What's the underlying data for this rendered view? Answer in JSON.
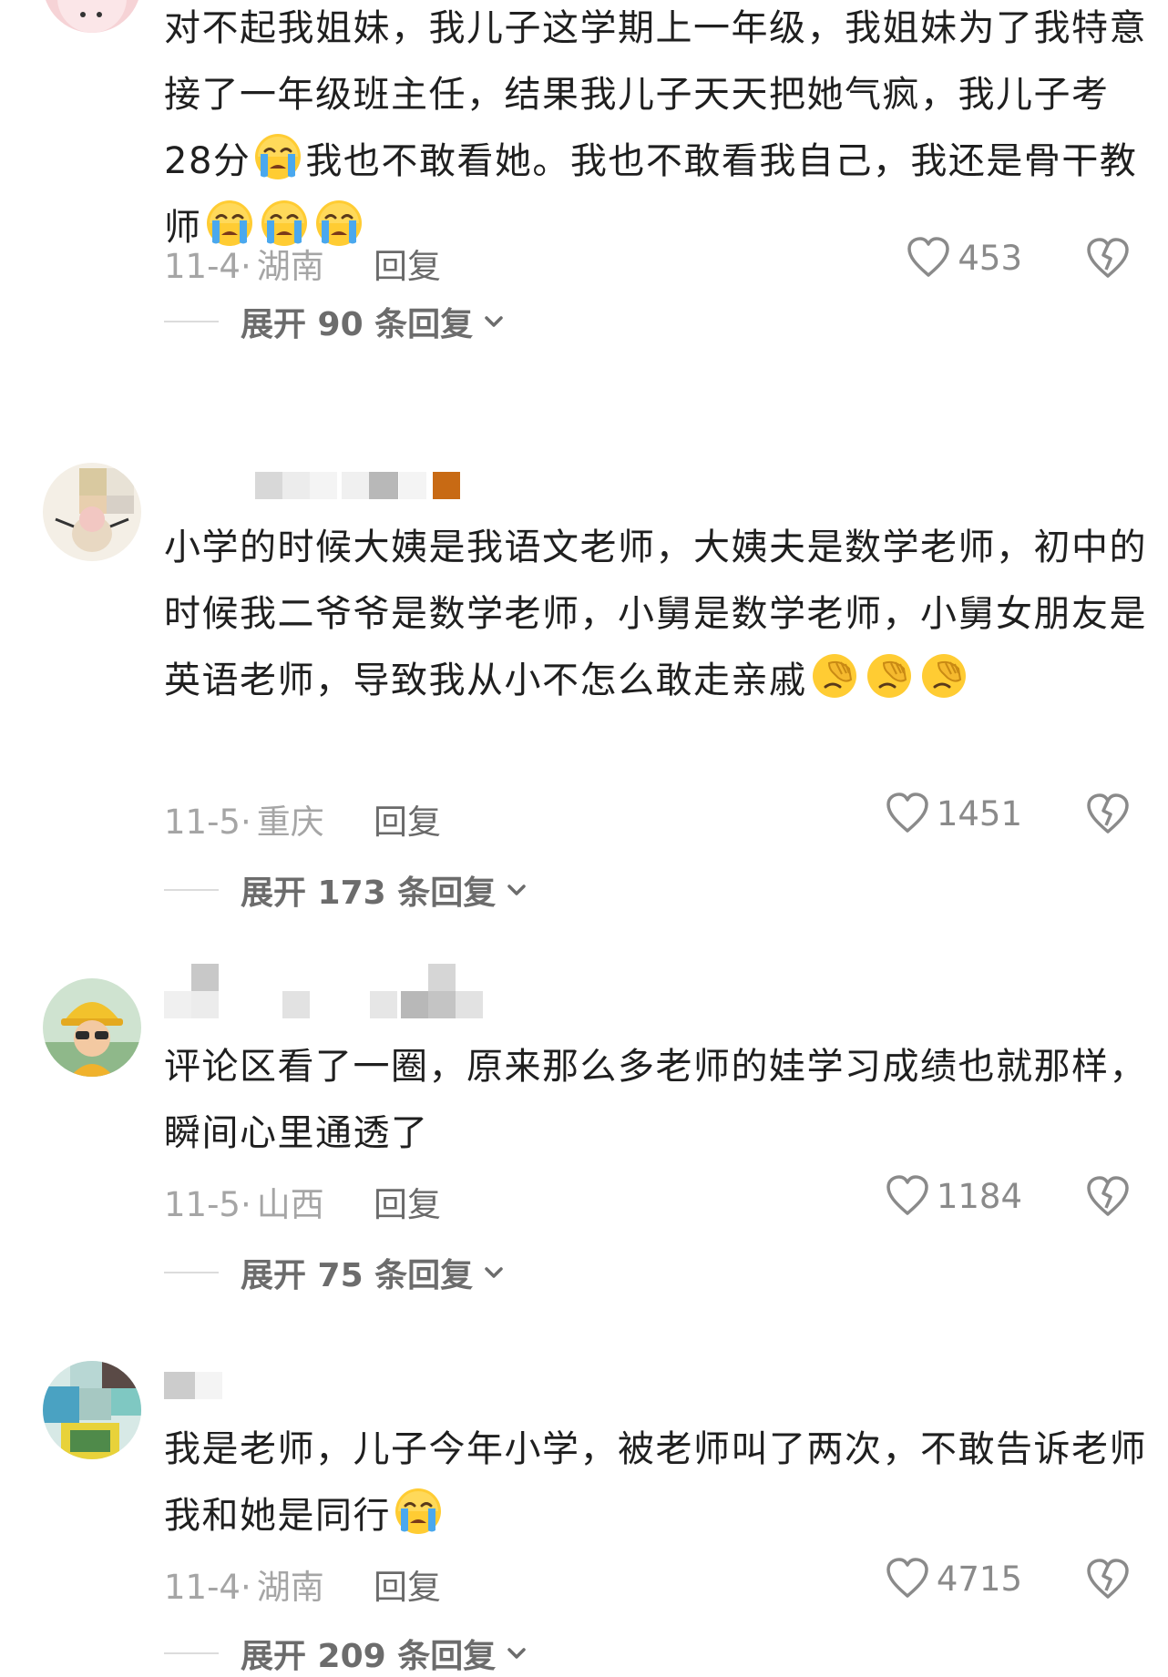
{
  "comments": [
    {
      "text_html": "对不起我姐妹，我儿子这学期上一年级，我姐妹为了我特意接了一年级班主任，结果我儿子天天把她气疯，我儿子考28分[cry]我也不敢看她。我也不敢看我自己，我还是骨干教师[cry][cry][cry]",
      "date": "11-4·",
      "location": "湖南",
      "reply_label": "回复",
      "likes": "453",
      "expand_label": "展开 90 条回复"
    },
    {
      "text_html": "小学的时候大姨是我语文老师，大姨夫是数学老师，初中的时候我二爷爷是数学老师，小舅是数学老师，小舅女朋友是英语老师，导致我从小不怎么敢走亲戚[facepalm][facepalm][facepalm]",
      "date": "11-5·",
      "location": "重庆",
      "reply_label": "回复",
      "likes": "1451",
      "expand_label": "展开 173 条回复"
    },
    {
      "text_html": "评论区看了一圈，原来那么多老师的娃学习成绩也就那样，瞬间心里通透了",
      "date": "11-5·",
      "location": "山西",
      "reply_label": "回复",
      "likes": "1184",
      "expand_label": "展开 75 条回复"
    },
    {
      "text_html": "我是老师，儿子今年小学，被老师叫了两次，不敢告诉老师我和她是同行[cry]",
      "date": "11-4·",
      "location": "湖南",
      "reply_label": "回复",
      "likes": "4715",
      "expand_label": "展开 209 条回复"
    }
  ],
  "icons": {
    "like": "heart-outline-icon",
    "dislike": "broken-heart-icon",
    "expand": "chevron-down-icon"
  },
  "colors": {
    "text": "#1f1f1f",
    "meta": "#a5a5a5",
    "reply": "#6a6a6a",
    "divider": "#dcdcdc"
  }
}
